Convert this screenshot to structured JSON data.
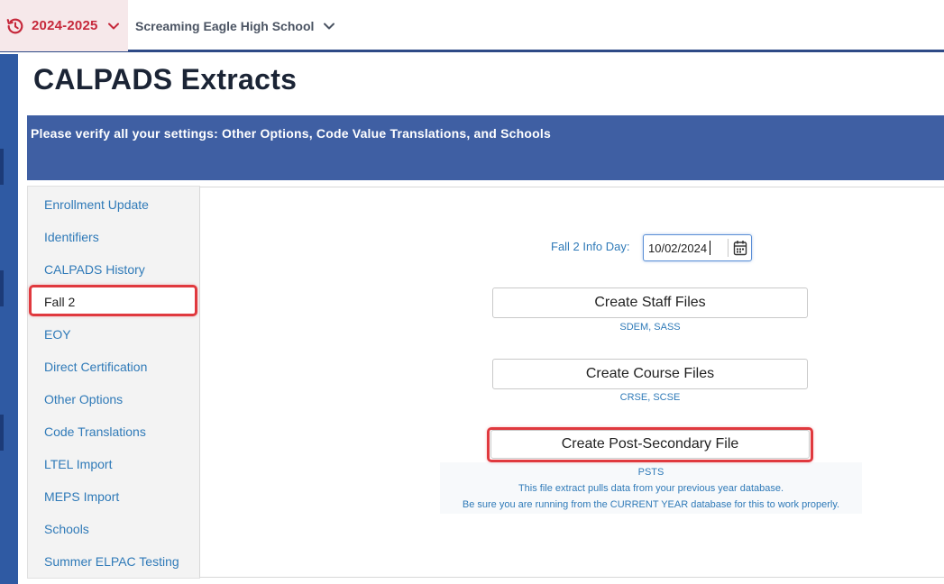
{
  "header": {
    "year": "2024-2025",
    "school": "Screaming Eagle High School"
  },
  "page": {
    "title": "CALPADS Extracts",
    "banner": "Please verify all your settings: Other Options, Code Value Translations, and Schools"
  },
  "sidenav": {
    "items": [
      {
        "label": "Enrollment Update"
      },
      {
        "label": "Identifiers"
      },
      {
        "label": "CALPADS History"
      },
      {
        "label": "Fall 2"
      },
      {
        "label": "EOY"
      },
      {
        "label": "Direct Certification"
      },
      {
        "label": "Other Options"
      },
      {
        "label": "Code Translations"
      },
      {
        "label": "LTEL Import"
      },
      {
        "label": "MEPS Import"
      },
      {
        "label": "Schools"
      },
      {
        "label": "Summer ELPAC Testing"
      }
    ],
    "active": "Fall 2"
  },
  "main": {
    "info_day_label": "Fall 2 Info Day:",
    "info_day_value": "10/02/2024",
    "staff_button": "Create Staff Files",
    "staff_sub": "SDEM, SASS",
    "course_button": "Create Course Files",
    "course_sub": "CRSE, SCSE",
    "post_button": "Create Post-Secondary File",
    "post_sub_1": "PSTS",
    "post_sub_2": "This file extract pulls data from your previous year database.",
    "post_sub_3": "Be sure you are running from the CURRENT YEAR database for this to work properly."
  },
  "colors": {
    "brand_navy": "#2e4a86",
    "banner": "#3f5fa3",
    "link": "#2f7ab8",
    "highlight": "#e0393e",
    "year_red": "#c6283b"
  },
  "icons": [
    "history-icon",
    "chevron-down-icon",
    "calendar-icon"
  ]
}
